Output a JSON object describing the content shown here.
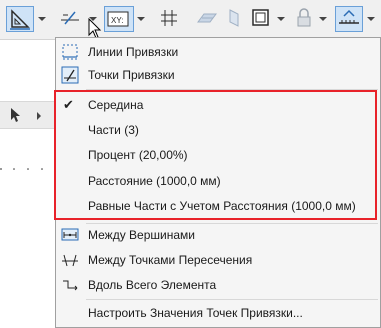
{
  "toolbar": {
    "buttons": [
      {
        "name": "guide-lines-tool",
        "active": true
      },
      {
        "name": "snap-points-tool",
        "active": false
      },
      {
        "name": "coordinates-tool",
        "active": true
      },
      {
        "name": "grid-snap-tool",
        "active": false
      },
      {
        "name": "plane-tool",
        "active": false
      },
      {
        "name": "parallelogram-tool",
        "active": false
      },
      {
        "name": "frame-tool",
        "active": false
      },
      {
        "name": "lock-tool",
        "active": false
      },
      {
        "name": "measure-tool",
        "active": true
      }
    ]
  },
  "menu": {
    "items": [
      {
        "id": "snap_lines",
        "label": "Линии Привязки",
        "icon": "snap-lines-icon"
      },
      {
        "id": "snap_points",
        "label": "Точки Привязки",
        "icon": "snap-points-icon"
      },
      {
        "id": "middle",
        "label": "Середина",
        "checked": true
      },
      {
        "id": "parts",
        "label": "Части (3)"
      },
      {
        "id": "percent",
        "label": "Процент (20,00%)"
      },
      {
        "id": "distance",
        "label": "Расстояние (1000,0 мм)"
      },
      {
        "id": "equal_parts",
        "label": "Равные Части с Учетом Расстояния (1000,0 мм)"
      },
      {
        "id": "between_vertices",
        "label": "Между Вершинами",
        "icon": "between-vertices-icon"
      },
      {
        "id": "between_intersections",
        "label": "Между Точками Пересечения",
        "icon": "between-intersections-icon"
      },
      {
        "id": "along_element",
        "label": "Вдоль Всего Элемента",
        "icon": "along-element-icon"
      },
      {
        "id": "configure",
        "label": "Настроить Значения Точек Привязки..."
      }
    ]
  },
  "colors": {
    "highlight_border": "#e8222a",
    "toolbar_active_bg": "#cfe3f7",
    "icon_blue": "#2b6cb5"
  }
}
